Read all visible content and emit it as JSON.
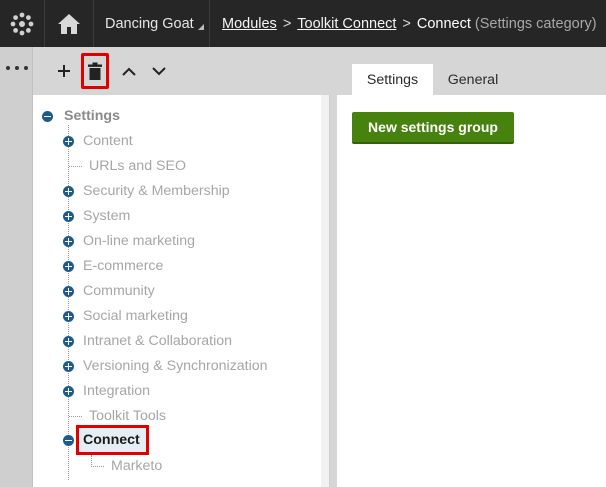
{
  "header": {
    "site_name": "Dancing Goat",
    "breadcrumb": {
      "modules": "Modules",
      "toolkit": "Toolkit Connect",
      "separator": ">",
      "current": "Connect",
      "category": "(Settings category)"
    }
  },
  "rail": {
    "more_label": "..."
  },
  "tree": {
    "root": "Settings",
    "items": [
      {
        "label": "Content"
      },
      {
        "label": "URLs and SEO"
      },
      {
        "label": "Security & Membership"
      },
      {
        "label": "System"
      },
      {
        "label": "On-line marketing"
      },
      {
        "label": "E-commerce"
      },
      {
        "label": "Community"
      },
      {
        "label": "Social marketing"
      },
      {
        "label": "Intranet & Collaboration"
      },
      {
        "label": "Versioning & Synchronization"
      },
      {
        "label": "Integration"
      },
      {
        "label": "Toolkit Tools"
      },
      {
        "label": "Connect"
      }
    ],
    "child": "Marketo"
  },
  "tabs": {
    "settings": "Settings",
    "general": "General"
  },
  "main": {
    "new_group_button": "New settings group"
  },
  "colors": {
    "header_bg": "#262626",
    "accent_blue": "#1d5b8f",
    "button_green": "#47820f",
    "highlight_red": "#e00000"
  }
}
